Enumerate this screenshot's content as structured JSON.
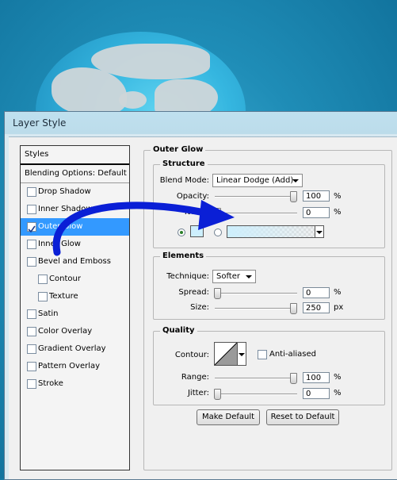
{
  "window": {
    "title": "Layer Style"
  },
  "sidebar": {
    "styles_label": "Styles",
    "blending_label": "Blending Options: Default",
    "items": [
      {
        "label": "Drop Shadow",
        "checked": false
      },
      {
        "label": "Inner Shadow",
        "checked": false
      },
      {
        "label": "Outer Glow",
        "checked": true,
        "selected": true
      },
      {
        "label": "Inner Glow",
        "checked": false
      },
      {
        "label": "Bevel and Emboss",
        "checked": false
      },
      {
        "label": "Contour",
        "checked": false
      },
      {
        "label": "Texture",
        "checked": false
      },
      {
        "label": "Satin",
        "checked": false
      },
      {
        "label": "Color Overlay",
        "checked": false
      },
      {
        "label": "Gradient Overlay",
        "checked": false
      },
      {
        "label": "Pattern Overlay",
        "checked": false
      },
      {
        "label": "Stroke",
        "checked": false
      }
    ]
  },
  "panel": {
    "title": "Outer Glow",
    "structure": {
      "title": "Structure",
      "blend_mode_label": "Blend Mode:",
      "blend_mode_value": "Linear Dodge (Add)",
      "opacity_label": "Opacity:",
      "opacity_value": "100",
      "opacity_unit": "%",
      "opacity_level": 1.0,
      "noise_label": "Noise:",
      "noise_value": "0",
      "noise_unit": "%",
      "noise_level": 0.0,
      "color_swatch": "#cdeffd"
    },
    "elements": {
      "title": "Elements",
      "technique_label": "Technique:",
      "technique_value": "Softer",
      "spread_label": "Spread:",
      "spread_value": "0",
      "spread_unit": "%",
      "spread_level": 0.0,
      "size_label": "Size:",
      "size_value": "250",
      "size_unit": "px",
      "size_level": 1.0
    },
    "quality": {
      "title": "Quality",
      "contour_label": "Contour:",
      "antialiased_label": "Anti-aliased",
      "range_label": "Range:",
      "range_value": "100",
      "range_unit": "%",
      "range_level": 1.0,
      "jitter_label": "Jitter:",
      "jitter_value": "0",
      "jitter_unit": "%",
      "jitter_level": 0.0
    },
    "buttons": {
      "make_default": "Make Default",
      "reset_default": "Reset to Default"
    }
  },
  "colors": {
    "accent_arrow": "#0a1fd6",
    "selection": "#3399ff"
  }
}
